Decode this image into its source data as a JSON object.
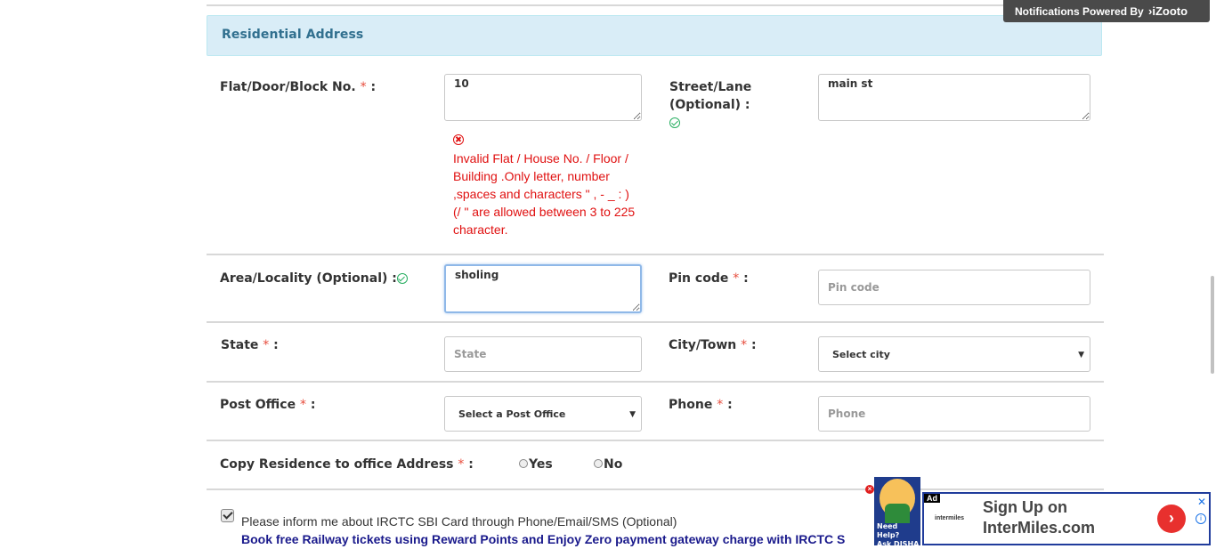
{
  "section": {
    "title": "Residential Address"
  },
  "labels": {
    "flat": "Flat/Door/Block No.",
    "street": "Street/Lane",
    "street_optional": "(Optional) :",
    "area": "Area/Locality (Optional) :",
    "pincode": "Pin code",
    "state": "State",
    "city": "City/Town",
    "post_office": "Post Office",
    "phone": "Phone",
    "copy": "Copy Residence to office Address",
    "required_mark": "*",
    "colon": ":"
  },
  "fields": {
    "flat_value": "10",
    "street_value": "main st",
    "area_value": "sholing",
    "pincode_placeholder": "Pin code",
    "state_placeholder": "State",
    "city_selected": "Select city",
    "post_office_selected": "Select a Post Office",
    "phone_placeholder": "Phone"
  },
  "error": {
    "flat": "Invalid Flat / House No. / Floor / Building .Only letter, number ,spaces and characters \" , - _ : ) (/ \" are allowed between 3 to 225 character."
  },
  "radio": {
    "yes": "Yes",
    "no": "No"
  },
  "consent": {
    "inform": "Please inform me about IRCTC SBI Card through Phone/Email/SMS (Optional)",
    "promo": "Book free Railway tickets using Reward Points and Enjoy Zero payment gateway charge with IRCTC S"
  },
  "notification": {
    "text": "Notifications Powered By",
    "brand": "iZooto"
  },
  "disha": {
    "line1": "Need Help?",
    "line2": "Ask DISHA"
  },
  "ad": {
    "tag": "Ad",
    "logo": "intermiles",
    "line1": "Sign Up on",
    "line2": "InterMiles.com",
    "close": "✕",
    "info": "i"
  },
  "colors": {
    "required": "#e74c3c",
    "error": "#e01010",
    "header_bg": "#d9edf7",
    "header_text": "#31708f",
    "valid": "#27ae60"
  }
}
